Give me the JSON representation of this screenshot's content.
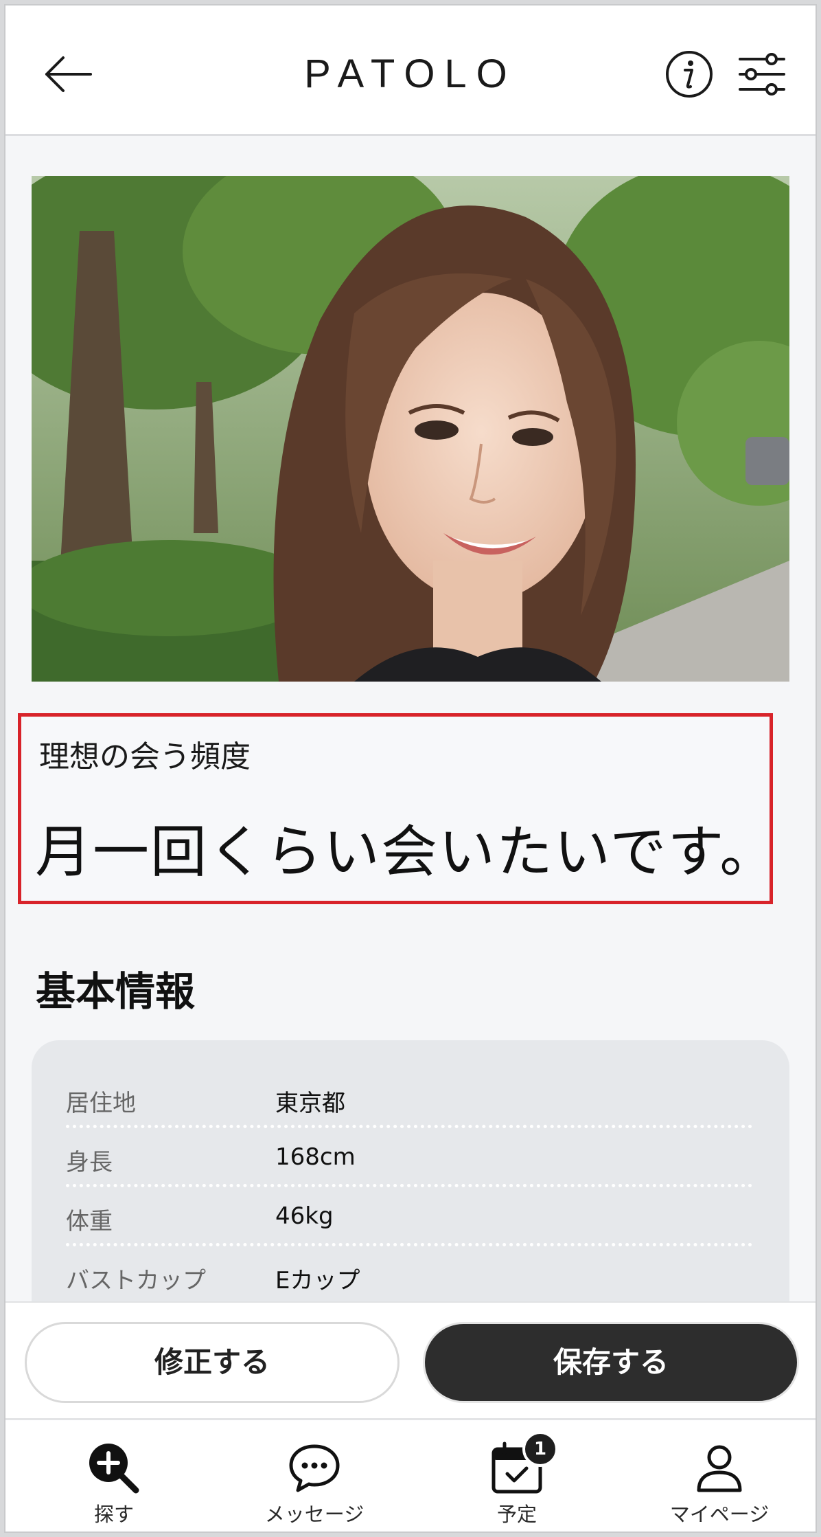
{
  "header": {
    "title": "PATOLO"
  },
  "ideal_frequency": {
    "label": "理想の会う頻度",
    "value": "月一回くらい会いたいです。"
  },
  "basic_info": {
    "title": "基本情報",
    "rows": [
      {
        "key": "居住地",
        "value": "東京都"
      },
      {
        "key": "身長",
        "value": "168cm"
      },
      {
        "key": "体重",
        "value": "46kg"
      },
      {
        "key": "バストカップ",
        "value": "Eカップ"
      }
    ]
  },
  "actions": {
    "edit_label": "修正する",
    "save_label": "保存する"
  },
  "bottom_nav": {
    "items": [
      {
        "label": "探す",
        "icon": "search-plus-icon"
      },
      {
        "label": "メッセージ",
        "icon": "chat-bubble-icon"
      },
      {
        "label": "予定",
        "icon": "calendar-check-icon",
        "badge": "1"
      },
      {
        "label": "マイページ",
        "icon": "user-icon"
      }
    ]
  },
  "colors": {
    "highlight_border": "#d8232a",
    "primary_button": "#2d2d2d"
  }
}
